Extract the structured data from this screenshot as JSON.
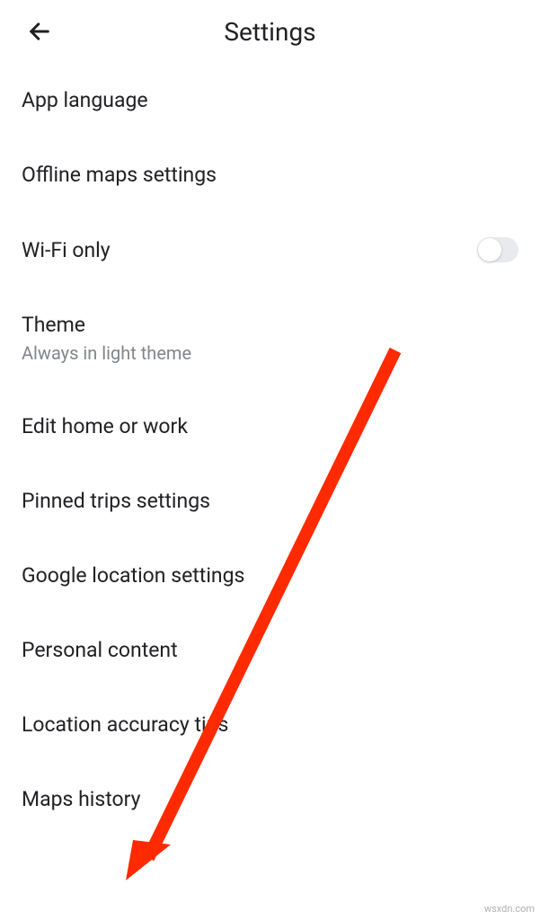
{
  "header": {
    "title": "Settings"
  },
  "settings": {
    "app_language": "App language",
    "offline_maps": "Offline maps settings",
    "wifi_only": "Wi-Fi only",
    "theme_label": "Theme",
    "theme_sublabel": "Always in light theme",
    "edit_home_work": "Edit home or work",
    "pinned_trips": "Pinned trips settings",
    "google_location": "Google location settings",
    "personal_content": "Personal content",
    "location_accuracy": "Location accuracy tips",
    "maps_history": "Maps history"
  },
  "watermark": "wsxdn.com"
}
